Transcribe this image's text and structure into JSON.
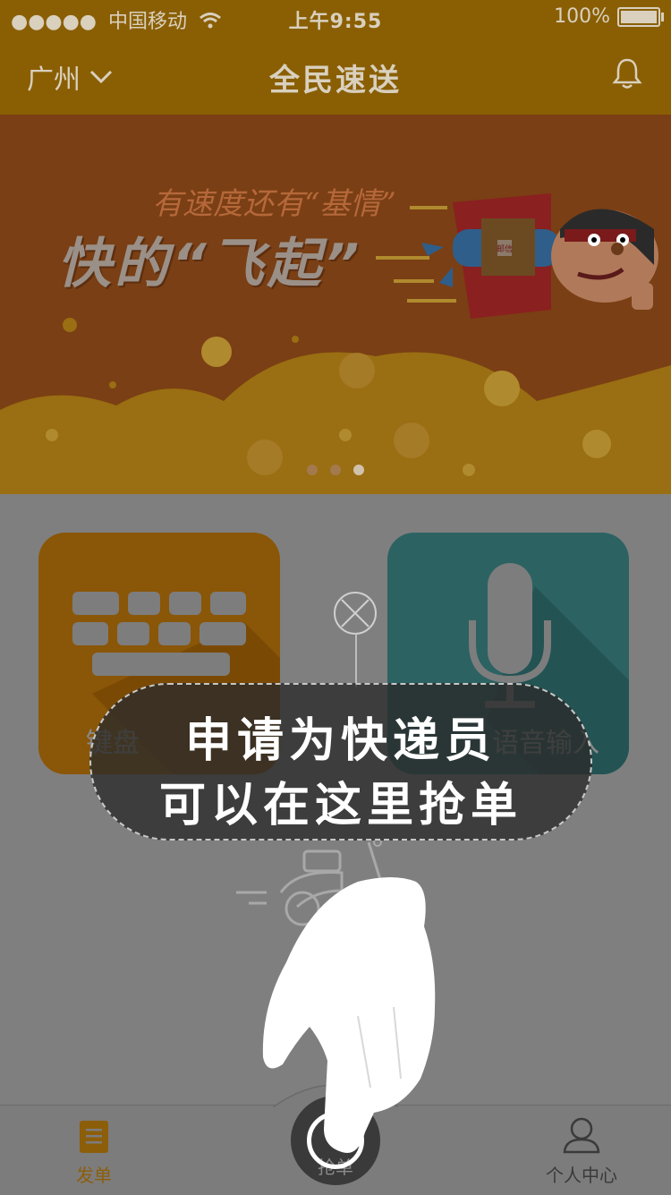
{
  "status_bar": {
    "signal": "●●●●●",
    "carrier": "中国移动",
    "time": "上午9:55",
    "battery": "100%"
  },
  "nav": {
    "city": "广州",
    "title": "全民速送"
  },
  "banner": {
    "slogan_small": "有速度还有“基情”",
    "slogan_big": "快的“飞起”",
    "package_label": "邮信",
    "page_count": 3,
    "active_page": 3
  },
  "cards": {
    "keyboard_label": "键盘",
    "voice_label": "语音输入"
  },
  "tooltip": {
    "line1": "申请为快递员",
    "line2": "可以在这里抢单"
  },
  "tabbar": {
    "send_label": "发单",
    "grab_label": "抢单",
    "profile_label": "个人中心"
  },
  "colors": {
    "header": "#8a5f04",
    "banner": "#7a3f14",
    "keyboard_card": "#8a5607",
    "voice_card": "#2c6262",
    "active_tab": "#8c5e0a"
  }
}
